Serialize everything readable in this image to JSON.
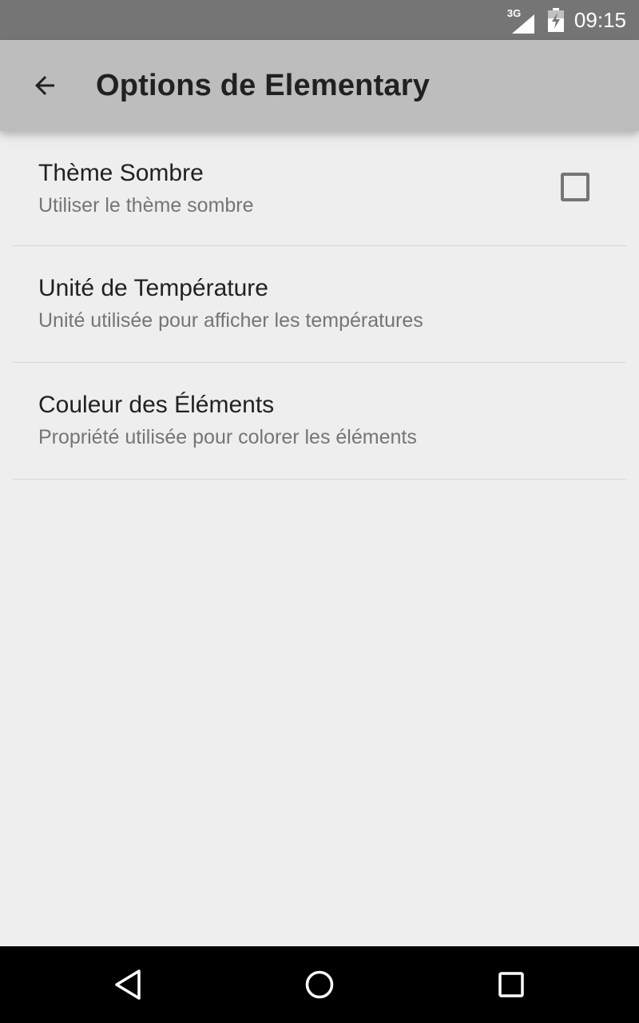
{
  "status_bar": {
    "network_label": "3G",
    "time": "09:15",
    "icons": [
      "signal-icon",
      "battery-charging-icon"
    ]
  },
  "app_bar": {
    "title": "Options de Elementary",
    "back_icon": "arrow-back-icon",
    "background_color": "#bdbdbd"
  },
  "preferences": [
    {
      "title": "Thème Sombre",
      "summary": "Utiliser le thème sombre",
      "widget": "checkbox",
      "checked": false
    },
    {
      "title": "Unité de Température",
      "summary": "Unité utilisée pour afficher les températures"
    },
    {
      "title": "Couleur des Éléments",
      "summary": "Propriété utilisée pour colorer les éléments"
    }
  ],
  "nav_bar": {
    "buttons": [
      "back-triangle-icon",
      "home-circle-icon",
      "recents-square-icon"
    ]
  },
  "colors": {
    "status_bar": "#757575",
    "page_background": "#eeeeee",
    "title_text": "#212121",
    "summary_text": "#757575"
  }
}
